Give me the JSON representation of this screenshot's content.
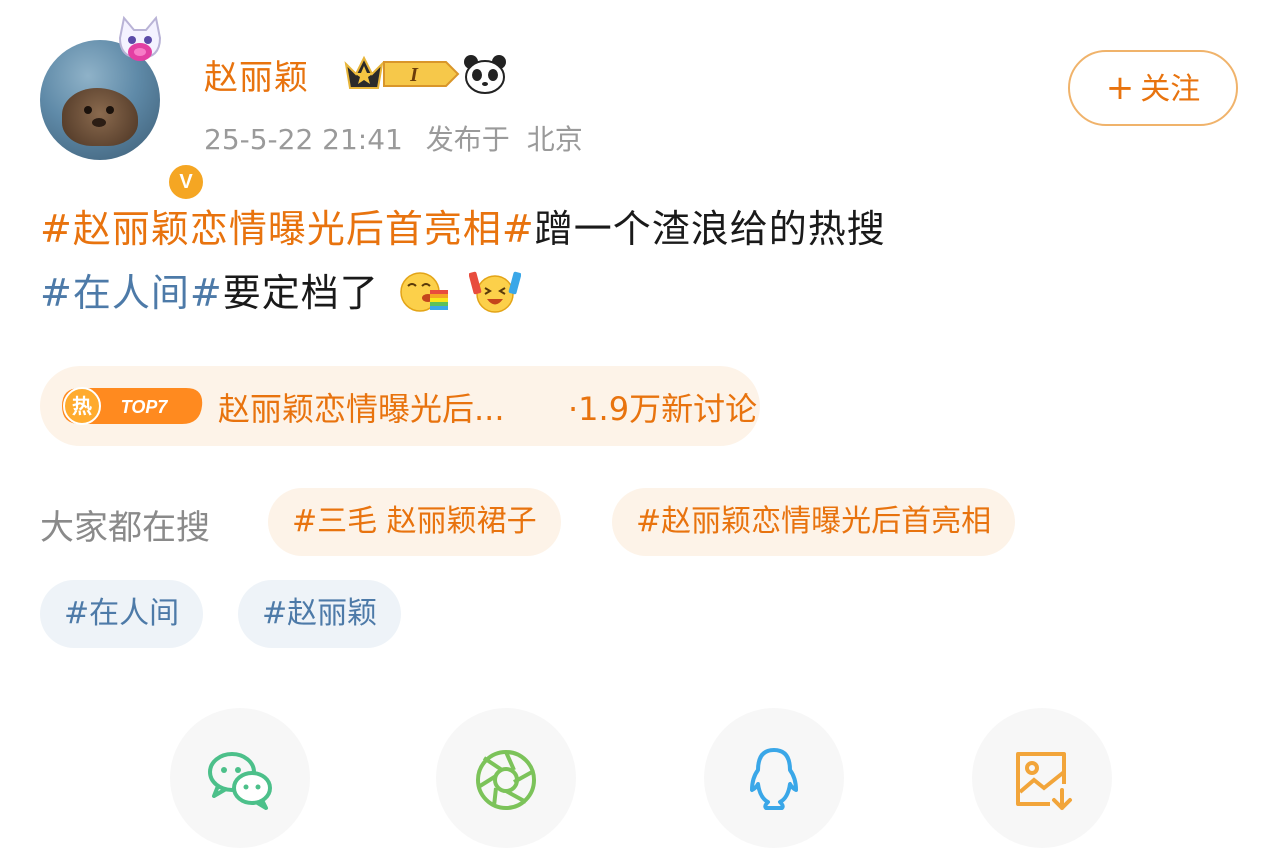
{
  "post": {
    "author": "赵丽颖",
    "timestamp": "25-5-22 21:41",
    "location_prefix": "发布于",
    "location": "北京",
    "verified_badge": "V",
    "level_badge": "I",
    "follow_label": "关注",
    "follow_plus": "+"
  },
  "content": {
    "line1_tag": "#赵丽颖恋情曝光后首亮相#",
    "line1_text": "蹭一个渣浪给的热搜",
    "line2_tag": "#在人间#",
    "line2_text": "要定档了"
  },
  "hot_search": {
    "badge_char": "热",
    "badge_rank": "TOP7",
    "title": "赵丽颖恋情曝光后...",
    "count": "·1.9万新讨论"
  },
  "everyone_search": {
    "label": "大家都在搜",
    "chips": [
      "#三毛 赵丽颖裙子",
      "#赵丽颖恋情曝光后首亮相",
      "#在人间",
      "#赵丽颖"
    ]
  },
  "colors": {
    "accent_orange": "#e8730e",
    "tag_blue": "#4d7aa8",
    "wechat_green": "#4cc08a",
    "moments_green": "#7cc35a",
    "qq_blue": "#3aa7e8",
    "save_orange": "#f2a53a"
  },
  "share_icons": [
    "wechat-icon",
    "moments-icon",
    "qq-icon",
    "save-image-icon"
  ]
}
